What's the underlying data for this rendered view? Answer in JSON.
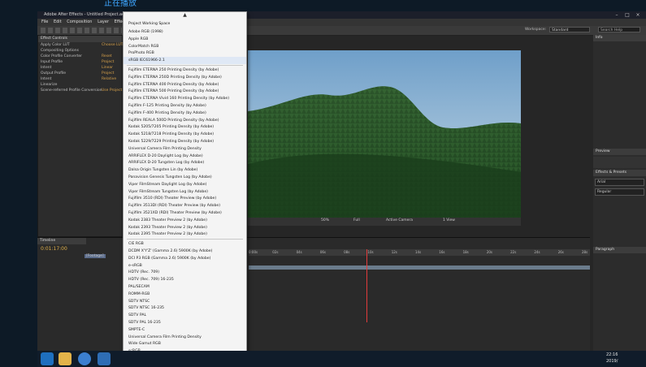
{
  "overlay": {
    "title": "正在播放"
  },
  "window": {
    "title": "Adobe After Effects - Untitled Project.aep *"
  },
  "menu": [
    "File",
    "Edit",
    "Composition",
    "Layer",
    "Effect"
  ],
  "toolbar": {
    "workspace_label": "Workspace:",
    "workspace_value": "Standard",
    "search_placeholder": "Search Help"
  },
  "effect_controls": {
    "tab": "Effect Controls",
    "rows": [
      {
        "label": "Apply Color LUT",
        "value": "Choose LUT"
      },
      {
        "label": "  Compositing Options",
        "value": ""
      },
      {
        "label": "Color Profile Converter",
        "value": "Reset"
      },
      {
        "label": "  Input Profile",
        "value": "Project"
      },
      {
        "label": "  Intent",
        "value": "Linear"
      },
      {
        "label": "  Output Profile",
        "value": "Project"
      },
      {
        "label": "  Intent",
        "value": "Relative"
      },
      {
        "label": "  Linearize",
        "value": ""
      },
      {
        "label": "  Scene-referred Profile Conversion",
        "value": "Use Project"
      }
    ]
  },
  "viewer": {
    "zoom": "50%",
    "resolution": "Full",
    "camera": "Active Camera",
    "view": "1 View"
  },
  "timeline": {
    "tab": "Timeline",
    "timecode": "0:01:17:00",
    "ticks": [
      "0:00s",
      "02s",
      "04s",
      "06s",
      "08s",
      "10s",
      "12s",
      "14s",
      "16s",
      "18s",
      "20s",
      "22s",
      "24s",
      "26s",
      "28s"
    ],
    "layer": "[Footage]"
  },
  "right_panels": {
    "info_tab": "Info",
    "preview_tab": "Preview",
    "effects_tab": "Effects & Presets",
    "paragraph_tab": "Paragraph",
    "character_tab": "Character",
    "font": "Arial",
    "style": "Regular"
  },
  "dropdown": {
    "header": "Project Working Space",
    "items": [
      "Adobe RGB (1998)",
      "Apple RGB",
      "ColorMatch RGB",
      "ProPhoto RGB",
      "sRGB IEC61966-2.1",
      "Fujifilm ETERNA 250 Printing Density (by Adobe)",
      "Fujifilm ETERNA 250D Printing Density (by Adobe)",
      "Fujifilm ETERNA 400 Printing Density (by Adobe)",
      "Fujifilm ETERNA 500 Printing Density (by Adobe)",
      "Fujifilm ETERNA Vivid 160 Printing Density (by Adobe)",
      "Fujifilm F-125 Printing Density (by Adobe)",
      "Fujifilm F-400 Printing Density (by Adobe)",
      "Fujifilm REALA 500D Printing Density (by Adobe)",
      "Kodak 5205/7205 Printing Density (by Adobe)",
      "Kodak 5218/7218 Printing Density (by Adobe)",
      "Kodak 5229/7229 Printing Density (by Adobe)",
      "Universal Camera Film Printing Density",
      "ARRIFLEX D-20 Daylight Log (by Adobe)",
      "ARRIFLEX D-20 Tungsten Log (by Adobe)",
      "Dalsa Origin Tungsten Lin (by Adobe)",
      "Panavision Genesis Tungsten Log (by Adobe)",
      "Viper FilmStream Daylight Log (by Adobe)",
      "Viper FilmStream Tungsten Log (by Adobe)",
      "Fujifilm 3510 (RDI) Theater Preview (by Adobe)",
      "Fujifilm 3513DI (RDI) Theater Preview (by Adobe)",
      "Fujifilm 3521XD (RDI) Theater Preview (by Adobe)",
      "Kodak 2383 Theater Preview 2 (by Adobe)",
      "Kodak 2393 Theater Preview 2 (by Adobe)",
      "Kodak 2395 Theater Preview 2 (by Adobe)",
      "CIE RGB",
      "DCDM X'Y'Z' (Gamma 2.6) 5900K (by Adobe)",
      "DCI P3 RGB (Gamma 2.6) 5900K (by Adobe)",
      "e-sRGB",
      "HDTV (Rec. 709)",
      "HDTV (Rec. 709) 16-235",
      "PAL/SECAM",
      "ROMM-RGB",
      "SDTV NTSC",
      "SDTV NTSC 16-235",
      "SDTV PAL",
      "SDTV PAL 16-235",
      "SMPTE-C",
      "Universal Camera Film Printing Density",
      "Wide Gamut RGB",
      "scRGB"
    ],
    "selected_index": 4
  },
  "taskbar": {
    "time": "22:16",
    "date": "2019/"
  },
  "colors": {
    "menu_bg": "#f4f4f4",
    "app_bg": "#262626",
    "accent": "#3ea6ff",
    "playhead": "#e23b3b"
  }
}
